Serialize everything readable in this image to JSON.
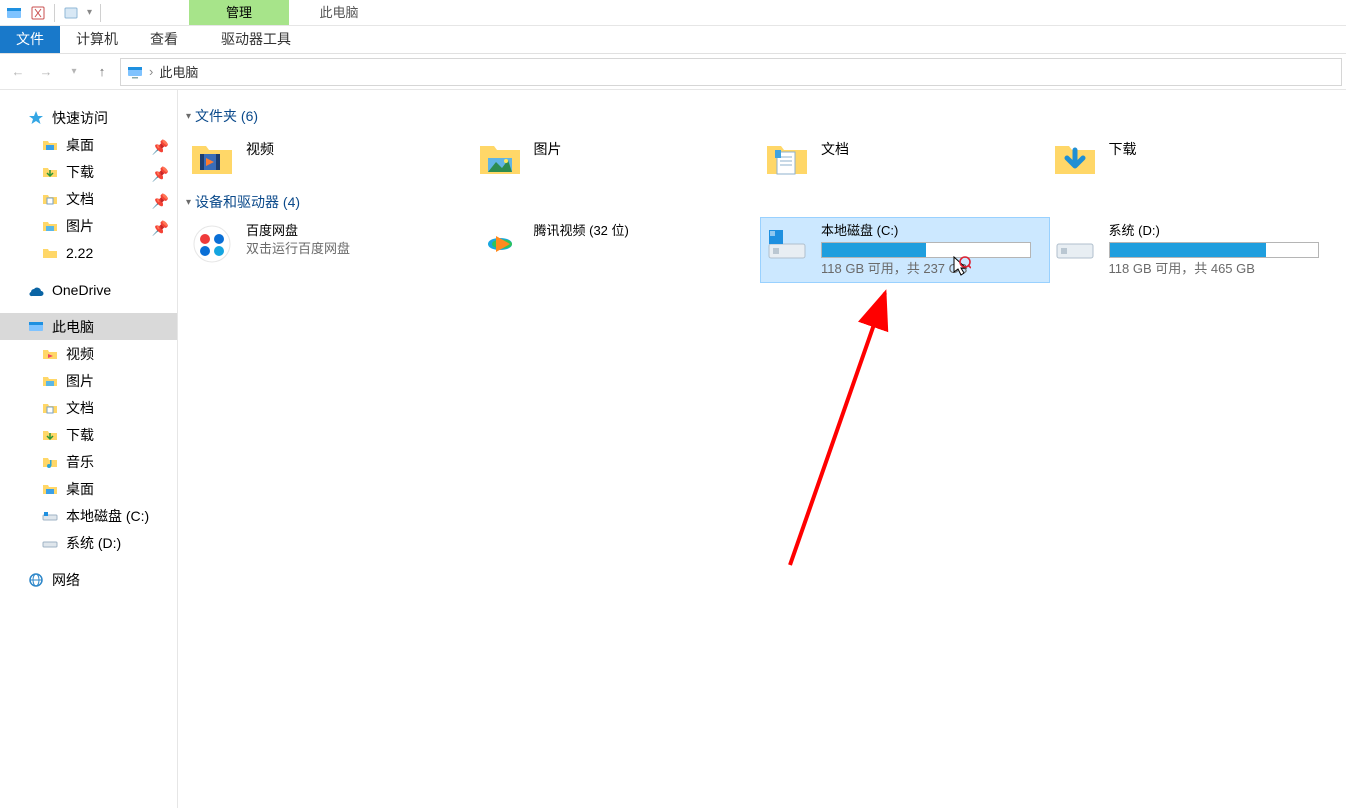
{
  "titlebar": {
    "context_label": "管理",
    "window_title": "此电脑"
  },
  "ribbon": {
    "file": "文件",
    "computer": "计算机",
    "view": "查看",
    "drive_tools": "驱动器工具"
  },
  "address": {
    "root": "此电脑"
  },
  "sidebar": {
    "quick_access": "快速访问",
    "desktop": "桌面",
    "downloads": "下载",
    "documents": "文档",
    "pictures": "图片",
    "folder_222": "2.22",
    "onedrive": "OneDrive",
    "this_pc": "此电脑",
    "videos": "视频",
    "pictures2": "图片",
    "documents2": "文档",
    "downloads2": "下载",
    "music": "音乐",
    "desktop2": "桌面",
    "local_c": "本地磁盘 (C:)",
    "system_d": "系统 (D:)",
    "network": "网络"
  },
  "groups": {
    "folders_header": "文件夹 (6)",
    "drives_header": "设备和驱动器 (4)"
  },
  "folders": {
    "videos": "视频",
    "pictures": "图片",
    "documents": "文档",
    "downloads": "下载"
  },
  "drives": {
    "baidu": {
      "name": "百度网盘",
      "sub": "双击运行百度网盘"
    },
    "tencent": {
      "name": "腾讯视频 (32 位)"
    },
    "c": {
      "name": "本地磁盘 (C:)",
      "text": "118 GB 可用，共 237 GB",
      "fill_pct": 50
    },
    "d": {
      "name": "系统 (D:)",
      "text": "118 GB 可用，共 465 GB",
      "fill_pct": 75
    }
  }
}
